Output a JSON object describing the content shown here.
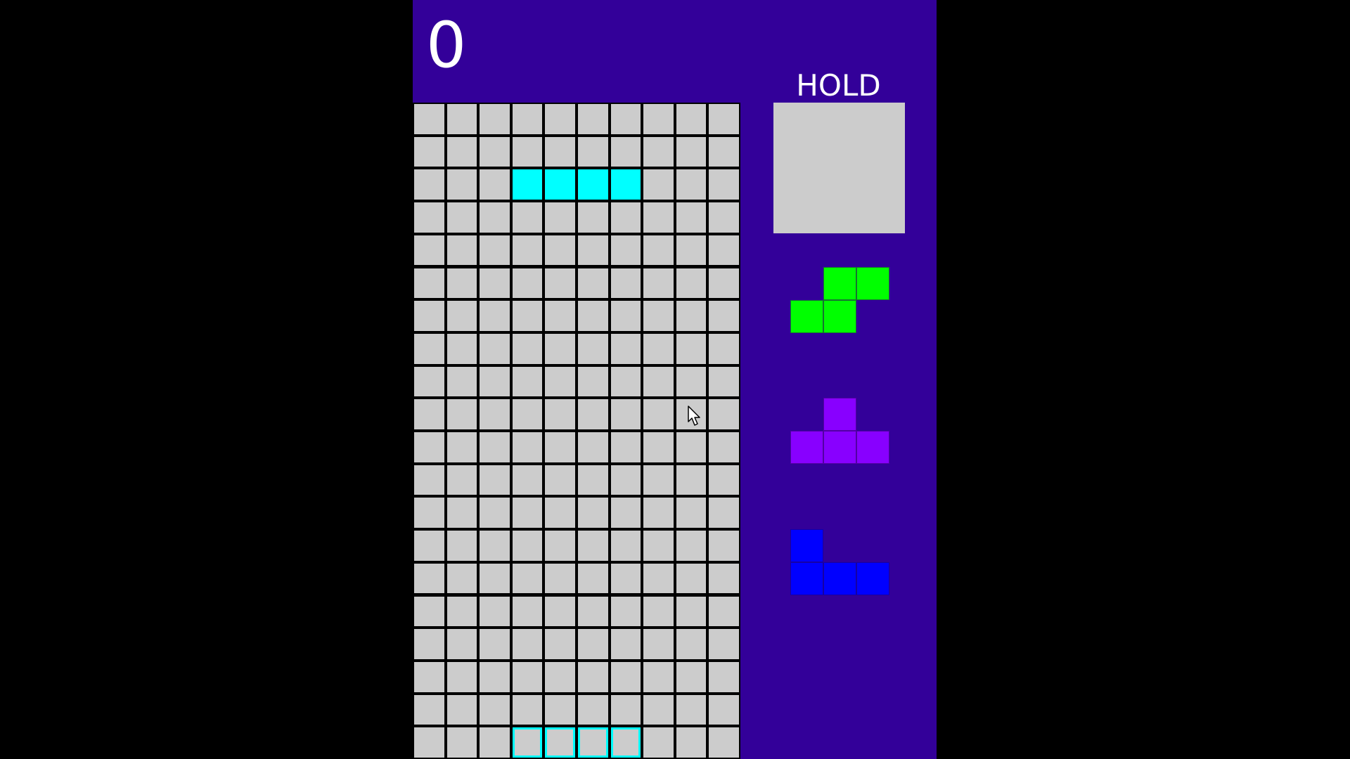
{
  "score": "0",
  "hold": {
    "label": "HOLD",
    "piece": null
  },
  "colors": {
    "panel": "#330099",
    "empty_cell": "#cccccc",
    "grid_line": "#000000",
    "I": "#00ffff",
    "S": "#00ff00",
    "T": "#8800ff",
    "J": "#0000ff"
  },
  "board": {
    "columns": 10,
    "rows": 20,
    "active_piece": {
      "type": "I",
      "cells": [
        [
          3,
          2
        ],
        [
          4,
          2
        ],
        [
          5,
          2
        ],
        [
          6,
          2
        ]
      ]
    },
    "ghost_piece": {
      "type": "I",
      "cells": [
        [
          3,
          19
        ],
        [
          4,
          19
        ],
        [
          5,
          19
        ],
        [
          6,
          19
        ]
      ]
    }
  },
  "next_queue": [
    {
      "type": "S",
      "cells": [
        [
          1,
          0
        ],
        [
          2,
          0
        ],
        [
          0,
          1
        ],
        [
          1,
          1
        ]
      ]
    },
    {
      "type": "T",
      "cells": [
        [
          1,
          0
        ],
        [
          0,
          1
        ],
        [
          1,
          1
        ],
        [
          2,
          1
        ]
      ]
    },
    {
      "type": "J",
      "cells": [
        [
          0,
          0
        ],
        [
          0,
          1
        ],
        [
          1,
          1
        ],
        [
          2,
          1
        ]
      ]
    }
  ],
  "cursor": "arrow-cursor-icon"
}
